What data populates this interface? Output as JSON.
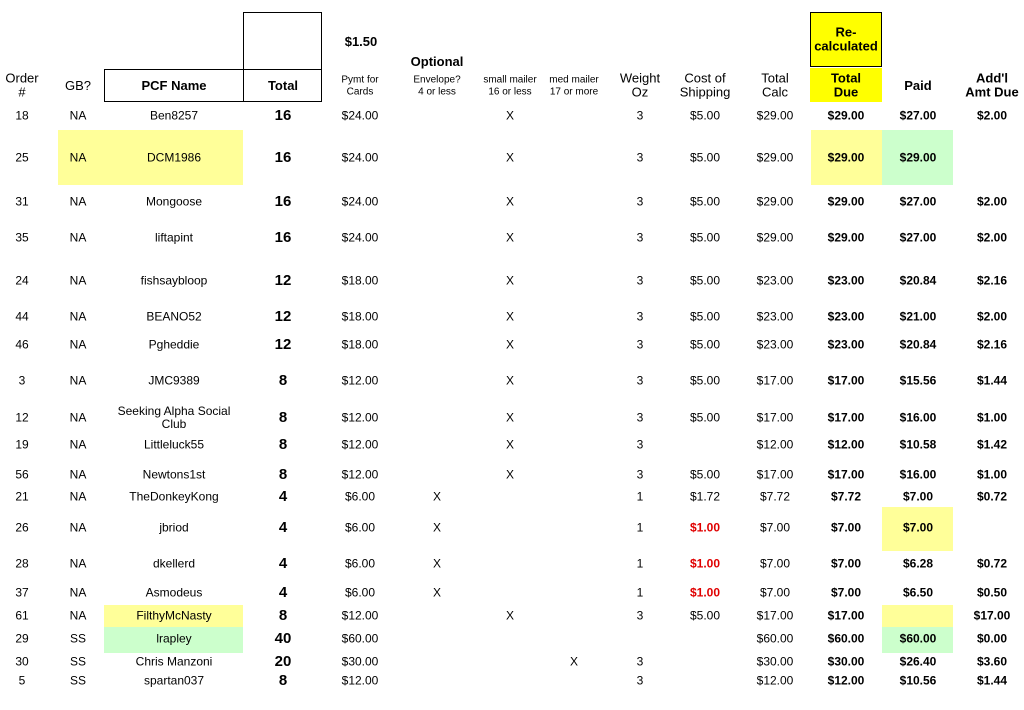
{
  "header": {
    "price_per_card": "$1.50",
    "optional": "Optional",
    "recalculated": "Re-\ncalculated",
    "order_num": "Order\n#",
    "gb": "GB?",
    "pcf_name": "PCF Name",
    "total": "Total",
    "pymt_for_cards": "Pymt for\nCards",
    "envelope": "Envelope?\n4 or less",
    "small_mailer": "small mailer\n16 or less",
    "med_mailer": "med mailer\n17 or more",
    "weight_oz": "Weight\nOz",
    "cost_of_shipping": "Cost of\nShipping",
    "total_calc": "Total\nCalc",
    "total_due": "Total\nDue",
    "paid": "Paid",
    "addl_amt_due": "Add'l\nAmt Due"
  },
  "colors": {
    "yellow_header": "#ffff00",
    "light_yellow": "#ffff99",
    "light_green": "#ccffcc",
    "red_text": "#e00000"
  },
  "rows": [
    {
      "order": "18",
      "gb": "NA",
      "name": "Ben8257",
      "total": "16",
      "pymt": "$24.00",
      "env": "",
      "small": "X",
      "med": "",
      "weight": "3",
      "ship": "$5.00",
      "calc": "$29.00",
      "due": "$29.00",
      "paid": "$27.00",
      "addl": "$2.00"
    },
    {
      "order": "25",
      "gb": "NA",
      "name": "DCM1986",
      "total": "16",
      "pymt": "$24.00",
      "env": "",
      "small": "X",
      "med": "",
      "weight": "3",
      "ship": "$5.00",
      "calc": "$29.00",
      "due": "$29.00",
      "paid": "$29.00",
      "addl": ""
    },
    {
      "order": "31",
      "gb": "NA",
      "name": "Mongoose",
      "total": "16",
      "pymt": "$24.00",
      "env": "",
      "small": "X",
      "med": "",
      "weight": "3",
      "ship": "$5.00",
      "calc": "$29.00",
      "due": "$29.00",
      "paid": "$27.00",
      "addl": "$2.00"
    },
    {
      "order": "35",
      "gb": "NA",
      "name": "liftapint",
      "total": "16",
      "pymt": "$24.00",
      "env": "",
      "small": "X",
      "med": "",
      "weight": "3",
      "ship": "$5.00",
      "calc": "$29.00",
      "due": "$29.00",
      "paid": "$27.00",
      "addl": "$2.00"
    },
    {
      "order": "24",
      "gb": "NA",
      "name": "fishsaybloop",
      "total": "12",
      "pymt": "$18.00",
      "env": "",
      "small": "X",
      "med": "",
      "weight": "3",
      "ship": "$5.00",
      "calc": "$23.00",
      "due": "$23.00",
      "paid": "$20.84",
      "addl": "$2.16"
    },
    {
      "order": "44",
      "gb": "NA",
      "name": "BEANO52",
      "total": "12",
      "pymt": "$18.00",
      "env": "",
      "small": "X",
      "med": "",
      "weight": "3",
      "ship": "$5.00",
      "calc": "$23.00",
      "due": "$23.00",
      "paid": "$21.00",
      "addl": "$2.00"
    },
    {
      "order": "46",
      "gb": "NA",
      "name": "Pgheddie",
      "total": "12",
      "pymt": "$18.00",
      "env": "",
      "small": "X",
      "med": "",
      "weight": "3",
      "ship": "$5.00",
      "calc": "$23.00",
      "due": "$23.00",
      "paid": "$20.84",
      "addl": "$2.16"
    },
    {
      "order": "3",
      "gb": "NA",
      "name": "JMC9389",
      "total": "8",
      "pymt": "$12.00",
      "env": "",
      "small": "X",
      "med": "",
      "weight": "3",
      "ship": "$5.00",
      "calc": "$17.00",
      "due": "$17.00",
      "paid": "$15.56",
      "addl": "$1.44"
    },
    {
      "order": "12",
      "gb": "NA",
      "name": "Seeking Alpha Social\nClub",
      "total": "8",
      "pymt": "$12.00",
      "env": "",
      "small": "X",
      "med": "",
      "weight": "3",
      "ship": "$5.00",
      "calc": "$17.00",
      "due": "$17.00",
      "paid": "$16.00",
      "addl": "$1.00"
    },
    {
      "order": "19",
      "gb": "NA",
      "name": "Littleluck55",
      "total": "8",
      "pymt": "$12.00",
      "env": "",
      "small": "X",
      "med": "",
      "weight": "3",
      "ship": "",
      "calc": "$12.00",
      "due": "$12.00",
      "paid": "$10.58",
      "addl": "$1.42"
    },
    {
      "order": "56",
      "gb": "NA",
      "name": "Newtons1st",
      "total": "8",
      "pymt": "$12.00",
      "env": "",
      "small": "X",
      "med": "",
      "weight": "3",
      "ship": "$5.00",
      "calc": "$17.00",
      "due": "$17.00",
      "paid": "$16.00",
      "addl": "$1.00"
    },
    {
      "order": "21",
      "gb": "NA",
      "name": "TheDonkeyKong",
      "total": "4",
      "pymt": "$6.00",
      "env": "X",
      "small": "",
      "med": "",
      "weight": "1",
      "ship": "$1.72",
      "calc": "$7.72",
      "due": "$7.72",
      "paid": "$7.00",
      "addl": "$0.72"
    },
    {
      "order": "26",
      "gb": "NA",
      "name": "jbriod",
      "total": "4",
      "pymt": "$6.00",
      "env": "X",
      "small": "",
      "med": "",
      "weight": "1",
      "ship": "$1.00",
      "calc": "$7.00",
      "due": "$7.00",
      "paid": "$7.00",
      "addl": ""
    },
    {
      "order": "28",
      "gb": "NA",
      "name": "dkellerd",
      "total": "4",
      "pymt": "$6.00",
      "env": "X",
      "small": "",
      "med": "",
      "weight": "1",
      "ship": "$1.00",
      "calc": "$7.00",
      "due": "$7.00",
      "paid": "$6.28",
      "addl": "$0.72"
    },
    {
      "order": "37",
      "gb": "NA",
      "name": "Asmodeus",
      "total": "4",
      "pymt": "$6.00",
      "env": "X",
      "small": "",
      "med": "",
      "weight": "1",
      "ship": "$1.00",
      "calc": "$7.00",
      "due": "$7.00",
      "paid": "$6.50",
      "addl": "$0.50"
    },
    {
      "order": "61",
      "gb": "NA",
      "name": "FilthyMcNasty",
      "total": "8",
      "pymt": "$12.00",
      "env": "",
      "small": "X",
      "med": "",
      "weight": "3",
      "ship": "$5.00",
      "calc": "$17.00",
      "due": "$17.00",
      "paid": "",
      "addl": "$17.00"
    },
    {
      "order": "29",
      "gb": "SS",
      "name": "lrapley",
      "total": "40",
      "pymt": "$60.00",
      "env": "",
      "small": "",
      "med": "",
      "weight": "",
      "ship": "",
      "calc": "$60.00",
      "due": "$60.00",
      "paid": "$60.00",
      "addl": "$0.00"
    },
    {
      "order": "30",
      "gb": "SS",
      "name": "Chris Manzoni",
      "total": "20",
      "pymt": "$30.00",
      "env": "",
      "small": "",
      "med": "X",
      "weight": "3",
      "ship": "",
      "calc": "$30.00",
      "due": "$30.00",
      "paid": "$26.40",
      "addl": "$3.60"
    },
    {
      "order": "5",
      "gb": "SS",
      "name": "spartan037",
      "total": "8",
      "pymt": "$12.00",
      "env": "",
      "small": "",
      "med": "",
      "weight": "3",
      "ship": "",
      "calc": "$12.00",
      "due": "$12.00",
      "paid": "$10.56",
      "addl": "$1.44"
    }
  ]
}
